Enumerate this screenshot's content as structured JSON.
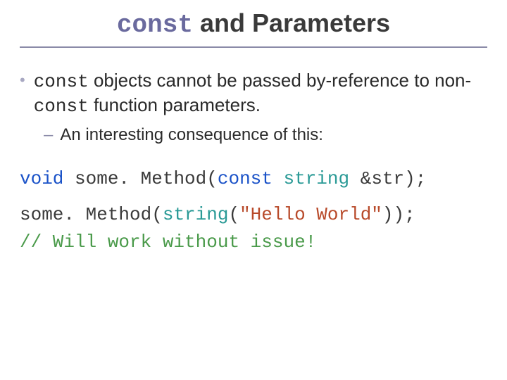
{
  "title": {
    "const_kw": "const",
    "rest": " and Parameters"
  },
  "bullet": {
    "pre": "",
    "const1": "const",
    "mid1": " objects cannot be passed by-reference to non-",
    "const2": "const",
    "mid2": " function parameters."
  },
  "sub": {
    "dash": "–",
    "text": "An interesting consequence of this:"
  },
  "code1": {
    "void": "void",
    "method": " some. Method(",
    "const": "const",
    "space": " ",
    "string": "string",
    "tail": " &str);"
  },
  "code2": {
    "method": "some. Method(",
    "string": "string",
    "lparen": "(",
    "lit": "\"Hello World\"",
    "tail": "));"
  },
  "code3": {
    "comment": "// Will work without issue!"
  }
}
